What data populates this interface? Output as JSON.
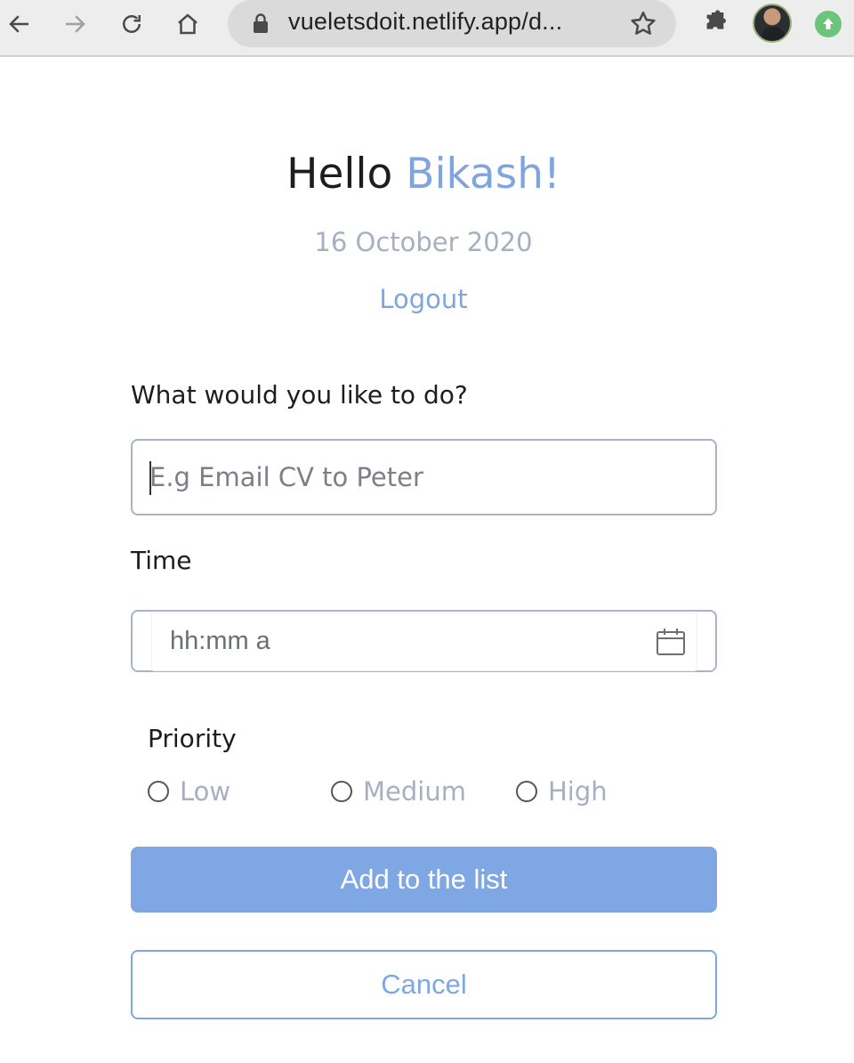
{
  "browser": {
    "url": "vueletsdoit.netlify.app/d...",
    "icons": [
      "back-icon",
      "forward-icon",
      "reload-icon",
      "home-icon",
      "lock-icon",
      "star-icon",
      "extensions-icon",
      "avatar",
      "update-icon"
    ]
  },
  "header": {
    "greeting": "Hello",
    "name": "Bikash!",
    "date": "16 October 2020",
    "logout_label": "Logout"
  },
  "form": {
    "task_label": "What would you like to do?",
    "task_placeholder": "E.g Email CV to Peter",
    "time_label": "Time",
    "time_placeholder": "hh:mm a",
    "priority_label": "Priority",
    "priority_options": [
      "Low",
      "Medium",
      "High"
    ],
    "add_button": "Add to the list",
    "cancel_button": "Cancel"
  },
  "colors": {
    "accent": "#7fa5e1",
    "muted": "#a6b0c2",
    "border": "#a8b3c8"
  }
}
